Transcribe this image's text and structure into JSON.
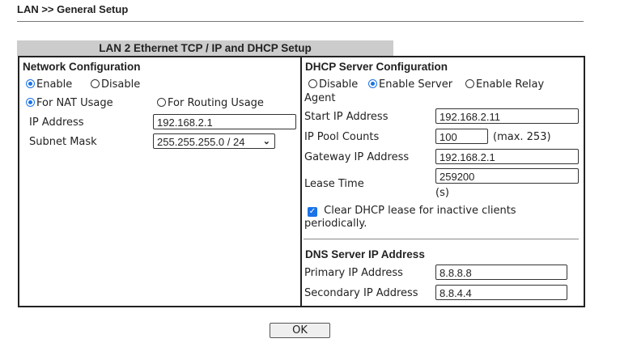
{
  "page": {
    "title": "LAN >> General Setup",
    "section_header": "LAN 2 Ethernet TCP / IP and DHCP Setup"
  },
  "network": {
    "heading": "Network Configuration",
    "enable": "Enable",
    "disable": "Disable",
    "nat": "For NAT Usage",
    "routing": "For Routing Usage",
    "ip_label": "IP Address",
    "ip_value": "192.168.2.1",
    "mask_label": "Subnet Mask",
    "mask_value": "255.255.255.0 / 24"
  },
  "dhcp": {
    "heading": "DHCP Server Configuration",
    "disable": "Disable",
    "enable_server": "Enable Server",
    "enable_relay": "Enable Relay",
    "agent": "Agent",
    "start_label": "Start IP Address",
    "start_value": "192.168.2.11",
    "pool_label": "IP Pool Counts",
    "pool_value": "100",
    "pool_max": "(max. 253)",
    "gw_label": "Gateway IP Address",
    "gw_value": "192.168.2.1",
    "lease_label": "Lease Time",
    "lease_value": "259200",
    "lease_unit": "(s)",
    "clear_label": "Clear DHCP lease for inactive clients",
    "clear_label2": "periodically."
  },
  "dns": {
    "heading": "DNS Server IP Address",
    "primary_label": "Primary IP Address",
    "primary_value": "8.8.8.8",
    "secondary_label": "Secondary IP Address",
    "secondary_value": "8.8.4.4"
  },
  "ok_label": "OK"
}
